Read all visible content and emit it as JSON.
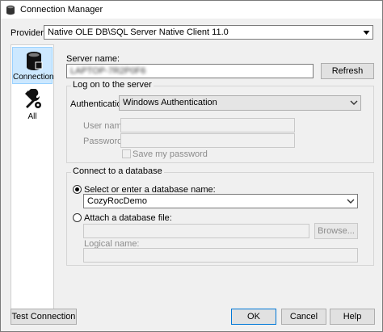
{
  "window": {
    "title": "Connection Manager",
    "icon": "database-icon"
  },
  "provider": {
    "label": "Provider:",
    "value": "Native OLE DB\\SQL Server Native Client 11.0"
  },
  "sidebar": {
    "items": [
      {
        "label": "Connection",
        "icon": "database-icon",
        "selected": true
      },
      {
        "label": "All",
        "icon": "tools-icon",
        "selected": false
      }
    ]
  },
  "server": {
    "label": "Server name:",
    "value": "LAPTOP-7R2P0F6",
    "refresh_label": "Refresh"
  },
  "logon": {
    "legend": "Log on to the server",
    "auth_label": "Authentication:",
    "auth_value": "Windows Authentication",
    "user_label": "User name:",
    "password_label": "Password:",
    "save_password_label": "Save my password"
  },
  "database": {
    "legend": "Connect to a database",
    "select_label": "Select or enter a database name:",
    "select_value": "CozyRocDemo",
    "attach_label": "Attach a database file:",
    "browse_label": "Browse...",
    "logical_label": "Logical name:"
  },
  "buttons": {
    "test": "Test Connection",
    "ok": "OK",
    "cancel": "Cancel",
    "help": "Help"
  },
  "colors": {
    "selection": "#cce8ff",
    "focus": "#0078d7"
  }
}
